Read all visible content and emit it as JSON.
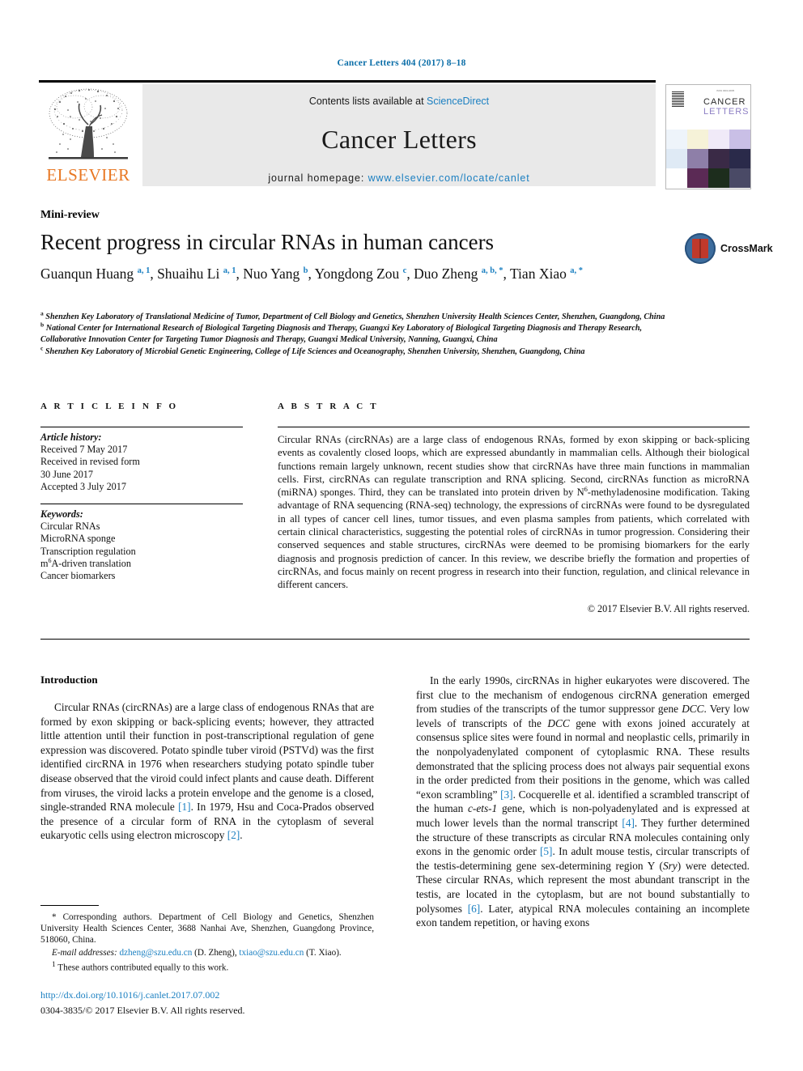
{
  "running_head": "Cancer Letters 404 (2017) 8–18",
  "masthead": {
    "publisher_logo_text": "ELSEVIER",
    "contents_prefix": "Contents lists available at ",
    "contents_link": "ScienceDirect",
    "journal_name": "Cancer Letters",
    "homepage_prefix": "journal homepage: ",
    "homepage_url": "www.elsevier.com/locate/canlet"
  },
  "cover": {
    "line1": "CANCER",
    "line2": "LETTERS",
    "tiny": "ISSN 0304-3835"
  },
  "article": {
    "type_label": "Mini-review",
    "title": "Recent progress in circular RNAs in human cancers",
    "crossmark_label": "CrossMark",
    "authors": [
      {
        "name": "Guanqun Huang",
        "sup": "a, 1",
        "sep": ", "
      },
      {
        "name": "Shuaihu Li",
        "sup": "a, 1",
        "sep": ", "
      },
      {
        "name": "Nuo Yang",
        "sup": "b",
        "sep": ", "
      },
      {
        "name": "Yongdong Zou",
        "sup": "c",
        "sep": ", "
      },
      {
        "name": "Duo Zheng",
        "sup": "a, b, *",
        "sep": ", "
      },
      {
        "name": "Tian Xiao",
        "sup": "a, *",
        "sep": ""
      }
    ],
    "affiliations": [
      {
        "mark": "a",
        "text": "Shenzhen Key Laboratory of Translational Medicine of Tumor, Department of Cell Biology and Genetics, Shenzhen University Health Sciences Center, Shenzhen, Guangdong, China"
      },
      {
        "mark": "b",
        "text": "National Center for International Research of Biological Targeting Diagnosis and Therapy, Guangxi Key Laboratory of Biological Targeting Diagnosis and Therapy Research, Collaborative Innovation Center for Targeting Tumor Diagnosis and Therapy, Guangxi Medical University, Nanning, Guangxi, China"
      },
      {
        "mark": "c",
        "text": "Shenzhen Key Laboratory of Microbial Genetic Engineering, College of Life Sciences and Oceanography, Shenzhen University, Shenzhen, Guangdong, China"
      }
    ]
  },
  "article_info": {
    "heading": "A R T I C L E  I N F O",
    "history_label": "Article history:",
    "history": [
      "Received 7 May 2017",
      "Received in revised form",
      "30 June 2017",
      "Accepted 3 July 2017"
    ],
    "keywords_label": "Keywords:",
    "keywords": [
      "Circular RNAs",
      "MicroRNA sponge",
      "Transcription regulation",
      "m6A-driven translation",
      "Cancer biomarkers"
    ]
  },
  "abstract": {
    "heading": "A B S T R A C T",
    "part1": "Circular RNAs (circRNAs) are a large class of endogenous RNAs, formed by exon skipping or back-splicing events as covalently closed loops, which are expressed abundantly in mammalian cells. Although their biological functions remain largely unknown, recent studies show that circRNAs have three main functions in mammalian cells. First, circRNAs can regulate transcription and RNA splicing. Second, circRNAs function as microRNA (miRNA) sponges. Third, they can be translated into protein driven by N",
    "sup": "6",
    "part2": "-methyladenosine modification. Taking advantage of RNA sequencing (RNA-seq) technology, the expressions of circRNAs were found to be dysregulated in all types of cancer cell lines, tumor tissues, and even plasma samples from patients, which correlated with certain clinical characteristics, suggesting the potential roles of circRNAs in tumor progression. Considering their conserved sequences and stable structures, circRNAs were deemed to be promising biomarkers for the early diagnosis and prognosis prediction of cancer. In this review, we describe briefly the formation and properties of circRNAs, and focus mainly on recent progress in research into their function, regulation, and clinical relevance in different cancers.",
    "copyright": "© 2017 Elsevier B.V. All rights reserved."
  },
  "body": {
    "intro_heading": "Introduction",
    "left_paragraph_1": "Circular RNAs (circRNAs) are a large class of endogenous RNAs that are formed by exon skipping or back-splicing events; however, they attracted little attention until their function in post-transcriptional regulation of gene expression was discovered. Potato spindle tuber viroid (PSTVd) was the first identified circRNA in 1976 when researchers studying potato spindle tuber disease observed that the viroid could infect plants and cause death. Different from viruses, the viroid lacks a protein envelope and the genome is a closed, single-stranded RNA molecule ",
    "left_ref_1": "[1]",
    "left_paragraph_1b": ". In 1979, Hsu and Coca-Prados observed the presence of a circular form of RNA in the cytoplasm of several eukaryotic cells using electron microscopy ",
    "left_ref_2": "[2]",
    "left_paragraph_1c": ".",
    "right_p1a": "In the early 1990s, circRNAs in higher eukaryotes were discovered. The first clue to the mechanism of endogenous circRNA generation emerged from studies of the transcripts of the tumor suppressor gene ",
    "right_it1": "DCC",
    "right_p1b": ". Very low levels of transcripts of the ",
    "right_it2": "DCC",
    "right_p1c": " gene with exons joined accurately at consensus splice sites were found in normal and neoplastic cells, primarily in the nonpolyadenylated component of cytoplasmic RNA. These results demonstrated that the splicing process does not always pair sequential exons in the order predicted from their positions in the genome, which was called “exon scrambling” ",
    "right_ref3": "[3]",
    "right_p1d": ". Cocquerelle et al. identified a scrambled transcript of the human ",
    "right_it3": "c-ets-1",
    "right_p1e": " gene, which is non-polyadenylated and is expressed at much lower levels than the normal transcript ",
    "right_ref4": "[4]",
    "right_p1f": ". They further determined the structure of these transcripts as circular RNA molecules containing only exons in the genomic order ",
    "right_ref5": "[5]",
    "right_p1g": ". In adult mouse testis, circular transcripts of the testis-determining gene sex-determining region Y (",
    "right_it4": "Sry",
    "right_p1h": ") were detected. These circular RNAs, which represent the most abundant transcript in the testis, are located in the cytoplasm, but are not bound substantially to polysomes ",
    "right_ref6": "[6]",
    "right_p1i": ". Later, atypical RNA molecules containing an incomplete exon tandem repetition, or having exons"
  },
  "footnotes": {
    "corresponding": "* Corresponding authors. Department of Cell Biology and Genetics, Shenzhen University Health Sciences Center, 3688 Nanhai Ave, Shenzhen, Guangdong Province, 518060, China.",
    "email_label": "E-mail addresses:",
    "email1": "dzheng@szu.edu.cn",
    "email1_who": " (D. Zheng), ",
    "email2": "txiao@szu.edu.cn",
    "email2_who": " (T. Xiao).",
    "equal_mark": "1",
    "equal_text": "These authors contributed equally to this work.",
    "doi": "http://dx.doi.org/10.1016/j.canlet.2017.07.002",
    "issn": "0304-3835/© 2017 Elsevier B.V. All rights reserved."
  },
  "colors": {
    "link": "#1a7fc1",
    "elsevier_orange": "#e87722",
    "band_gray": "#e9e9e9"
  }
}
